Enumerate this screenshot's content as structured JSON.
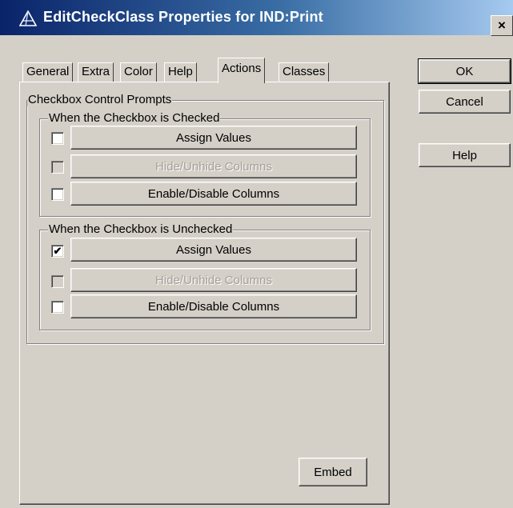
{
  "window": {
    "title": "EditCheckClass Properties for IND:Print",
    "close_label": "×"
  },
  "tabs": [
    {
      "label": "General",
      "active": false
    },
    {
      "label": "Extra",
      "active": false
    },
    {
      "label": "Color",
      "active": false
    },
    {
      "label": "Help",
      "active": false
    },
    {
      "label": "Actions",
      "active": true
    },
    {
      "label": "Classes",
      "active": false
    }
  ],
  "panel": {
    "outer_group_label": "Checkbox Control Prompts",
    "checked_group": {
      "label": "When the Checkbox is Checked",
      "rows": [
        {
          "button": "Assign Values",
          "checked": false,
          "enabled": true
        },
        {
          "button": "Hide/Unhide Columns",
          "checked": false,
          "enabled": false
        },
        {
          "button": "Enable/Disable Columns",
          "checked": false,
          "enabled": true
        }
      ]
    },
    "unchecked_group": {
      "label": "When the Checkbox is Unchecked",
      "rows": [
        {
          "button": "Assign Values",
          "checked": true,
          "enabled": true
        },
        {
          "button": "Hide/Unhide Columns",
          "checked": false,
          "enabled": false
        },
        {
          "button": "Enable/Disable Columns",
          "checked": false,
          "enabled": true
        }
      ]
    },
    "embed_label": "Embed"
  },
  "side_buttons": {
    "ok": "OK",
    "cancel": "Cancel",
    "help": "Help"
  },
  "checkmark_glyph": "✔",
  "icons": {
    "title_icon": "triangle-compass-icon"
  },
  "colors": {
    "titlebar_start": "#0a246a",
    "titlebar_end": "#a6caf0",
    "face": "#d4d0c8",
    "disabled_text": "#a4a098"
  }
}
